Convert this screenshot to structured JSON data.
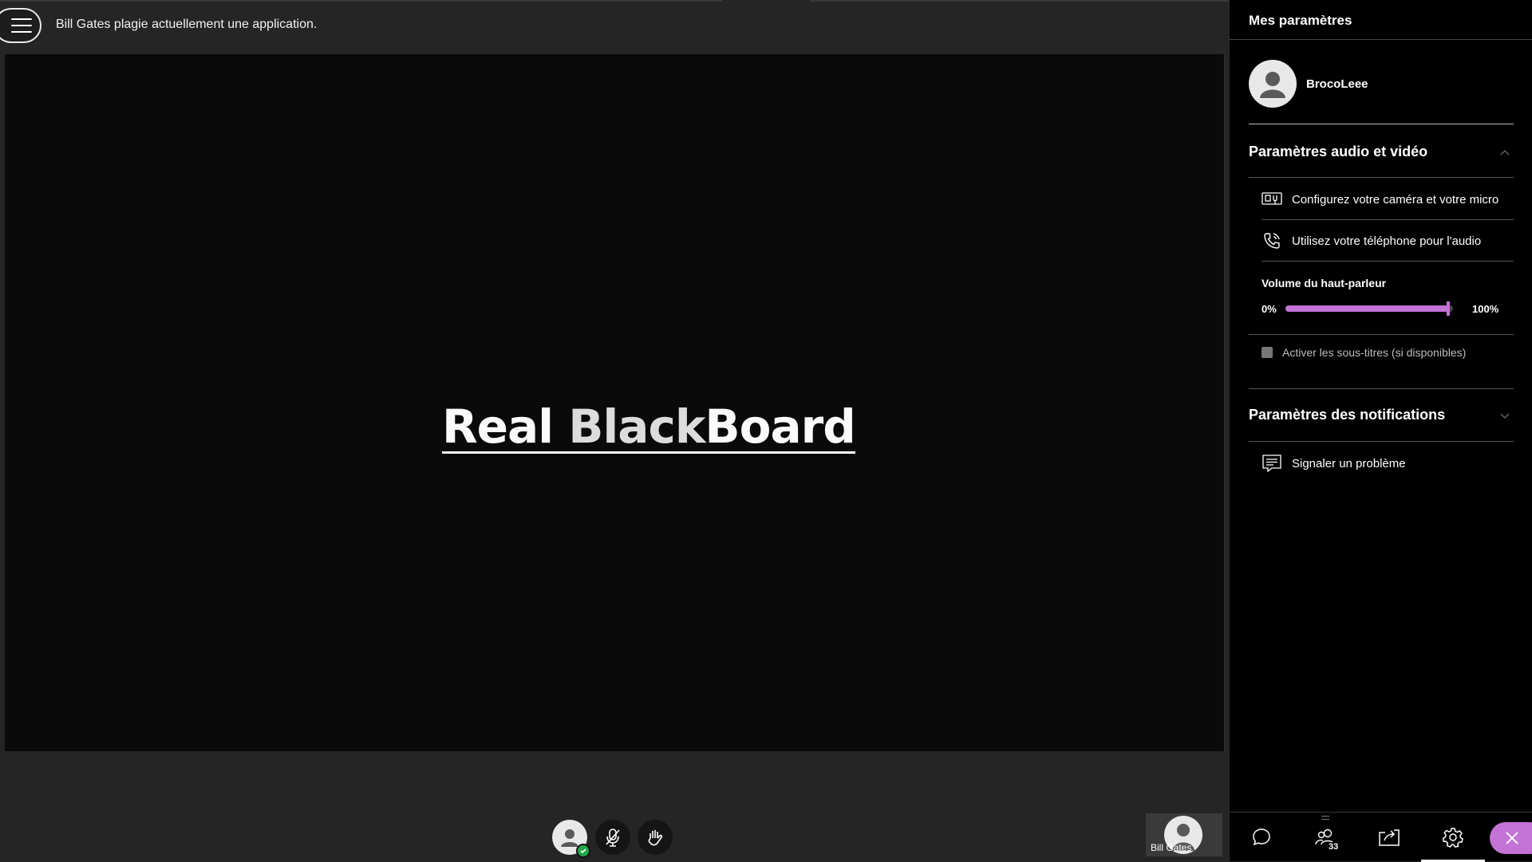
{
  "topbar": {
    "status_text": "Bill Gates plagie actuellement une application."
  },
  "share": {
    "title_part1": "Real ",
    "title_part2": "Black",
    "title_part3": "Board"
  },
  "self_tile": {
    "name": "Bill Gates"
  },
  "panel": {
    "title": "Mes paramètres",
    "profile_name": "BrocoLeee",
    "audio_video": {
      "title": "Paramètres audio et vidéo",
      "options": [
        {
          "label": "Configurez votre caméra et votre micro",
          "icon": "camera-mic-icon"
        },
        {
          "label": "Utilisez votre téléphone pour l'audio",
          "icon": "phone-icon"
        }
      ],
      "volume": {
        "label": "Volume du haut-parleur",
        "min_label": "0%",
        "max_label": "100%",
        "value_fraction": 0.97
      },
      "subtitles_label": "Activer les sous-titres (si disponibles)"
    },
    "notifications": {
      "title": "Paramètres des notifications"
    },
    "report": {
      "label": "Signaler un problème"
    },
    "nav": {
      "participants_count": "33"
    }
  },
  "colors": {
    "accent": "#c373d6",
    "online": "#21a847",
    "stage_bg": "#0a0a0a",
    "chrome_bg": "#252525",
    "panel_bg": "#000000"
  }
}
